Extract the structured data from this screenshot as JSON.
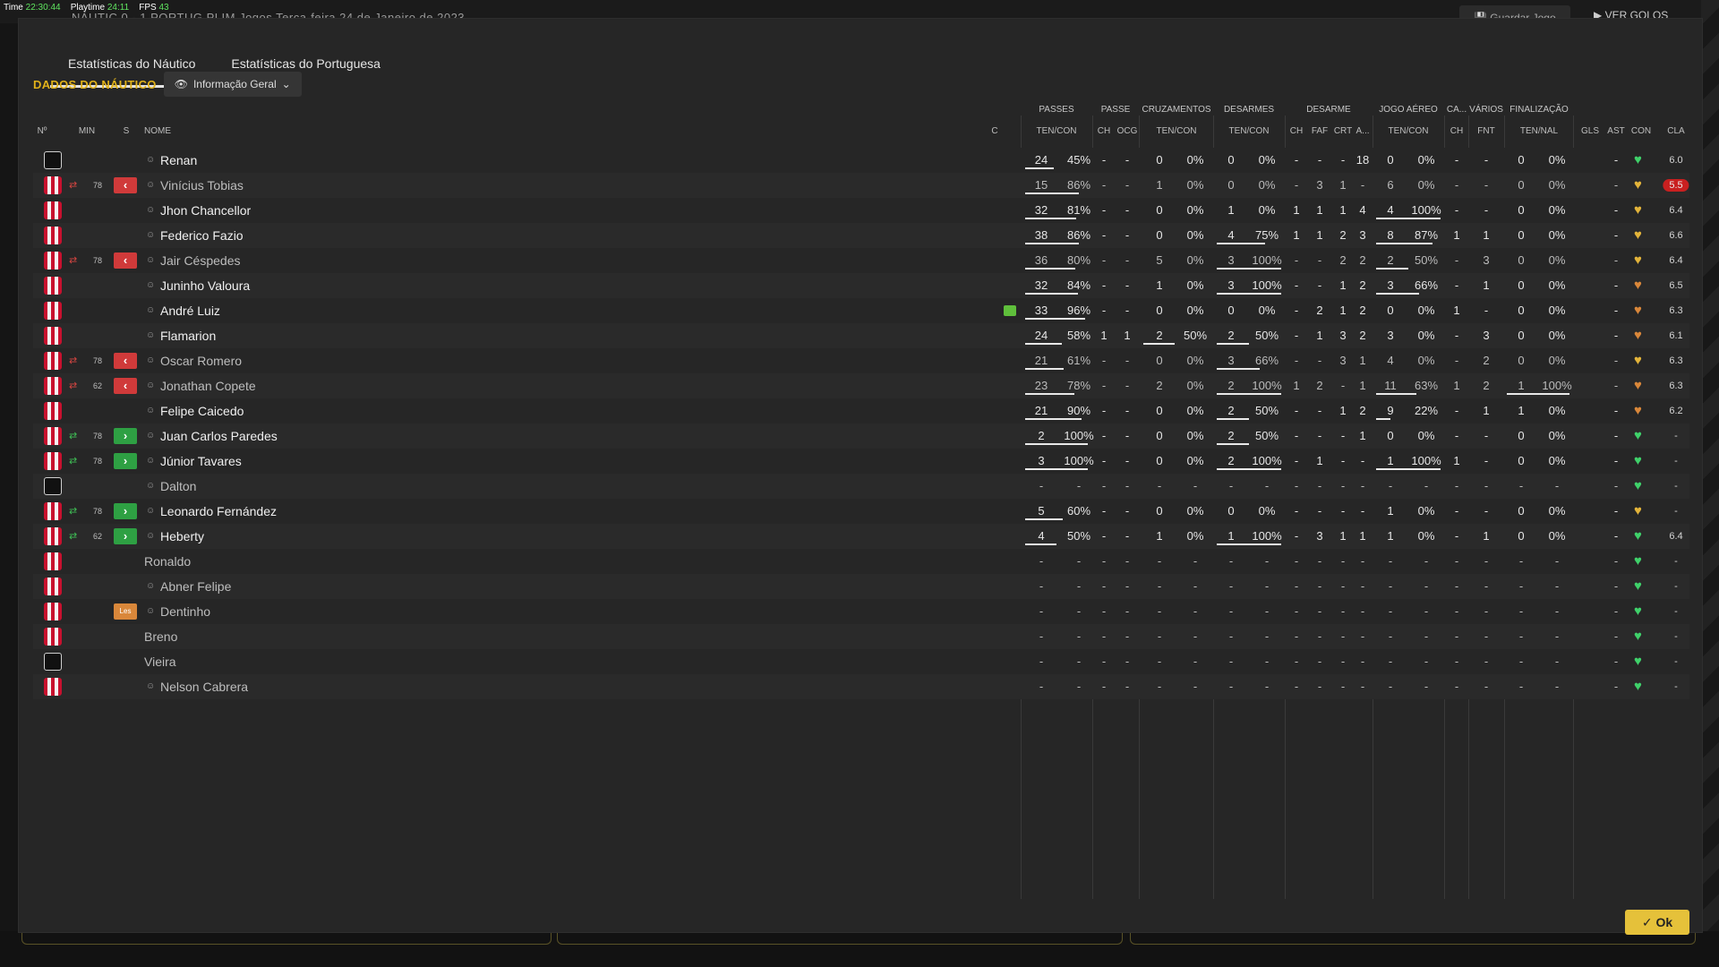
{
  "overlay": {
    "time_label": "Time",
    "time": "22:30:44",
    "playtime_label": "Playtime",
    "playtime": "24:11",
    "fps_label": "FPS",
    "fps": "43"
  },
  "background": {
    "match_text": "NÁUTIC  0 - 1  PORTUG   PLIM Jogos   Terça-feira 24 de Janeiro de 2023",
    "save_label": "Guardar Jogo",
    "goals_label": "VER GOLOS"
  },
  "tabs": [
    {
      "label": "Estatísticas do Náutico"
    },
    {
      "label": "Estatísticas do Portuguesa"
    }
  ],
  "section_title": "DADOS DO NÁUTICO",
  "dropdown": {
    "label": "Informação Geral"
  },
  "group_headers": [
    {
      "label": "PASSES"
    },
    {
      "label": "PASSE"
    },
    {
      "label": "CRUZAMENTOS"
    },
    {
      "label": "DESARMES"
    },
    {
      "label": "DESARME"
    },
    {
      "label": "JOGO AÉREO"
    },
    {
      "label": "CA..."
    },
    {
      "label": "VÁRIOS"
    },
    {
      "label": "FINALIZAÇÃO"
    }
  ],
  "columns": {
    "no": "Nº",
    "min": "MIN",
    "s": "S",
    "name": "NOME",
    "c": "C",
    "passes": "TEN/CON",
    "passe_ch": "CH",
    "passe_ocg": "OCG",
    "cruz": "TEN/CON",
    "des": "TEN/CON",
    "ds_ch": "CH",
    "ds_faf": "FAF",
    "ds_crt": "CRT",
    "ds_a": "A...",
    "aer": "TEN/CON",
    "ca_ch": "CH",
    "fnt": "FNT",
    "fin": "TEN/NAL",
    "gls": "GLS",
    "ast": "AST",
    "con": "CON",
    "cla": "CLA"
  },
  "colors": {
    "accent": "#e0b11a",
    "sub_out": "#d03a3a",
    "sub_in": "#2ea043",
    "heart_green": "#3fd16a",
    "heart_gold": "#e3b43a",
    "heart_orange": "#d9873a",
    "rating_bad": "#c92020"
  },
  "players": [
    {
      "gk": true,
      "sub": "",
      "min": "",
      "s": "",
      "name": "Renan",
      "person": true,
      "card": false,
      "pt": "24",
      "pp": "45%",
      "pb": 0.45,
      "pch": "-",
      "pocg": "-",
      "ct": "0",
      "cp": "0%",
      "cb": 0,
      "dt": "0",
      "dp": "0%",
      "db": 0,
      "dch": "-",
      "dfaf": "-",
      "dcrt": "-",
      "da": "18",
      "at": "0",
      "ap": "0%",
      "ab": 0,
      "cach": "-",
      "fnt": "-",
      "ft": "0",
      "fp": "0%",
      "fb": 0,
      "gls": "",
      "ast": "-",
      "con": "green",
      "cla": "6.0",
      "bad": false,
      "dim": false
    },
    {
      "gk": false,
      "sub": "out",
      "min": "78",
      "s": "out",
      "name": "Vinícius Tobias",
      "person": true,
      "card": false,
      "pt": "15",
      "pp": "86%",
      "pb": 0.86,
      "pch": "-",
      "pocg": "-",
      "ct": "1",
      "cp": "0%",
      "cb": 0,
      "dt": "0",
      "dp": "0%",
      "db": 0,
      "dch": "-",
      "dfaf": "3",
      "dcrt": "1",
      "da": "-",
      "at": "6",
      "ap": "0%",
      "ab": 0,
      "cach": "-",
      "fnt": "-",
      "ft": "0",
      "fp": "0%",
      "fb": 0,
      "gls": "",
      "ast": "-",
      "con": "gold",
      "cla": "5.5",
      "bad": true,
      "dim": true
    },
    {
      "gk": false,
      "sub": "",
      "min": "",
      "s": "",
      "name": "Jhon Chancellor",
      "person": true,
      "card": false,
      "pt": "32",
      "pp": "81%",
      "pb": 0.81,
      "pch": "-",
      "pocg": "-",
      "ct": "0",
      "cp": "0%",
      "cb": 0,
      "dt": "1",
      "dp": "0%",
      "db": 0,
      "dch": "1",
      "dfaf": "1",
      "dcrt": "1",
      "da": "4",
      "at": "4",
      "ap": "100%",
      "ab": 1,
      "cach": "-",
      "fnt": "-",
      "ft": "0",
      "fp": "0%",
      "fb": 0,
      "gls": "",
      "ast": "-",
      "con": "gold",
      "cla": "6.4",
      "bad": false,
      "dim": false
    },
    {
      "gk": false,
      "sub": "",
      "min": "",
      "s": "",
      "name": "Federico Fazio",
      "person": true,
      "card": false,
      "pt": "38",
      "pp": "86%",
      "pb": 0.86,
      "pch": "-",
      "pocg": "-",
      "ct": "0",
      "cp": "0%",
      "cb": 0,
      "dt": "4",
      "dp": "75%",
      "db": 0.75,
      "dch": "1",
      "dfaf": "1",
      "dcrt": "2",
      "da": "3",
      "at": "8",
      "ap": "87%",
      "ab": 0.87,
      "cach": "1",
      "fnt": "1",
      "ft": "0",
      "fp": "0%",
      "fb": 0,
      "gls": "",
      "ast": "-",
      "con": "gold",
      "cla": "6.6",
      "bad": false,
      "dim": false
    },
    {
      "gk": false,
      "sub": "out",
      "min": "78",
      "s": "out",
      "name": "Jair Céspedes",
      "person": true,
      "card": false,
      "pt": "36",
      "pp": "80%",
      "pb": 0.8,
      "pch": "-",
      "pocg": "-",
      "ct": "5",
      "cp": "0%",
      "cb": 0,
      "dt": "3",
      "dp": "100%",
      "db": 1,
      "dch": "-",
      "dfaf": "-",
      "dcrt": "2",
      "da": "2",
      "at": "2",
      "ap": "50%",
      "ab": 0.5,
      "cach": "-",
      "fnt": "3",
      "ft": "0",
      "fp": "0%",
      "fb": 0,
      "gls": "",
      "ast": "-",
      "con": "gold",
      "cla": "6.4",
      "bad": false,
      "dim": true
    },
    {
      "gk": false,
      "sub": "",
      "min": "",
      "s": "",
      "name": "Juninho Valoura",
      "person": true,
      "card": false,
      "pt": "32",
      "pp": "84%",
      "pb": 0.84,
      "pch": "-",
      "pocg": "-",
      "ct": "1",
      "cp": "0%",
      "cb": 0,
      "dt": "3",
      "dp": "100%",
      "db": 1,
      "dch": "-",
      "dfaf": "-",
      "dcrt": "1",
      "da": "2",
      "at": "3",
      "ap": "66%",
      "ab": 0.66,
      "cach": "-",
      "fnt": "1",
      "ft": "0",
      "fp": "0%",
      "fb": 0,
      "gls": "",
      "ast": "-",
      "con": "orange",
      "cla": "6.5",
      "bad": false,
      "dim": false
    },
    {
      "gk": false,
      "sub": "",
      "min": "",
      "s": "",
      "name": "André Luiz",
      "person": true,
      "card": true,
      "pt": "33",
      "pp": "96%",
      "pb": 0.96,
      "pch": "-",
      "pocg": "-",
      "ct": "0",
      "cp": "0%",
      "cb": 0,
      "dt": "0",
      "dp": "0%",
      "db": 0,
      "dch": "-",
      "dfaf": "2",
      "dcrt": "1",
      "da": "2",
      "at": "0",
      "ap": "0%",
      "ab": 0,
      "cach": "1",
      "fnt": "-",
      "ft": "0",
      "fp": "0%",
      "fb": 0,
      "gls": "",
      "ast": "-",
      "con": "orange",
      "cla": "6.3",
      "bad": false,
      "dim": false
    },
    {
      "gk": false,
      "sub": "",
      "min": "",
      "s": "",
      "name": "Flamarion",
      "person": true,
      "card": false,
      "pt": "24",
      "pp": "58%",
      "pb": 0.58,
      "pch": "1",
      "pocg": "1",
      "ct": "2",
      "cp": "50%",
      "cb": 0.5,
      "dt": "2",
      "dp": "50%",
      "db": 0.5,
      "dch": "-",
      "dfaf": "1",
      "dcrt": "3",
      "da": "2",
      "at": "3",
      "ap": "0%",
      "ab": 0,
      "cach": "-",
      "fnt": "3",
      "ft": "0",
      "fp": "0%",
      "fb": 0,
      "gls": "",
      "ast": "-",
      "con": "orange",
      "cla": "6.1",
      "bad": false,
      "dim": false
    },
    {
      "gk": false,
      "sub": "out",
      "min": "78",
      "s": "out",
      "name": "Oscar Romero",
      "person": true,
      "card": false,
      "pt": "21",
      "pp": "61%",
      "pb": 0.61,
      "pch": "-",
      "pocg": "-",
      "ct": "0",
      "cp": "0%",
      "cb": 0,
      "dt": "3",
      "dp": "66%",
      "db": 0.66,
      "dch": "-",
      "dfaf": "-",
      "dcrt": "3",
      "da": "1",
      "at": "4",
      "ap": "0%",
      "ab": 0,
      "cach": "-",
      "fnt": "2",
      "ft": "0",
      "fp": "0%",
      "fb": 0,
      "gls": "",
      "ast": "-",
      "con": "gold",
      "cla": "6.3",
      "bad": false,
      "dim": true
    },
    {
      "gk": false,
      "sub": "out",
      "min": "62",
      "s": "out",
      "name": "Jonathan Copete",
      "person": true,
      "card": false,
      "pt": "23",
      "pp": "78%",
      "pb": 0.78,
      "pch": "-",
      "pocg": "-",
      "ct": "2",
      "cp": "0%",
      "cb": 0,
      "dt": "2",
      "dp": "100%",
      "db": 1,
      "dch": "1",
      "dfaf": "2",
      "dcrt": "-",
      "da": "1",
      "at": "11",
      "ap": "63%",
      "ab": 0.63,
      "cach": "1",
      "fnt": "2",
      "ft": "1",
      "fp": "100%",
      "fb": 1,
      "gls": "",
      "ast": "-",
      "con": "orange",
      "cla": "6.3",
      "bad": false,
      "dim": true
    },
    {
      "gk": false,
      "sub": "",
      "min": "",
      "s": "",
      "name": "Felipe Caicedo",
      "person": true,
      "card": false,
      "pt": "21",
      "pp": "90%",
      "pb": 0.9,
      "pch": "-",
      "pocg": "-",
      "ct": "0",
      "cp": "0%",
      "cb": 0,
      "dt": "2",
      "dp": "50%",
      "db": 0.5,
      "dch": "-",
      "dfaf": "-",
      "dcrt": "1",
      "da": "2",
      "at": "9",
      "ap": "22%",
      "ab": 0.22,
      "cach": "-",
      "fnt": "1",
      "ft": "1",
      "fp": "0%",
      "fb": 0,
      "gls": "",
      "ast": "-",
      "con": "orange",
      "cla": "6.2",
      "bad": false,
      "dim": false
    },
    {
      "gk": false,
      "sub": "in",
      "min": "78",
      "s": "in",
      "name": "Juan Carlos Paredes",
      "person": true,
      "card": false,
      "pt": "2",
      "pp": "100%",
      "pb": 1,
      "pch": "-",
      "pocg": "-",
      "ct": "0",
      "cp": "0%",
      "cb": 0,
      "dt": "2",
      "dp": "50%",
      "db": 0.5,
      "dch": "-",
      "dfaf": "-",
      "dcrt": "-",
      "da": "1",
      "at": "0",
      "ap": "0%",
      "ab": 0,
      "cach": "-",
      "fnt": "-",
      "ft": "0",
      "fp": "0%",
      "fb": 0,
      "gls": "",
      "ast": "-",
      "con": "green",
      "cla": "-",
      "bad": false,
      "dim": false
    },
    {
      "gk": false,
      "sub": "in",
      "min": "78",
      "s": "in",
      "name": "Júnior Tavares",
      "person": true,
      "card": false,
      "pt": "3",
      "pp": "100%",
      "pb": 1,
      "pch": "-",
      "pocg": "-",
      "ct": "0",
      "cp": "0%",
      "cb": 0,
      "dt": "2",
      "dp": "100%",
      "db": 1,
      "dch": "-",
      "dfaf": "1",
      "dcrt": "-",
      "da": "-",
      "at": "1",
      "ap": "100%",
      "ab": 1,
      "cach": "1",
      "fnt": "-",
      "ft": "0",
      "fp": "0%",
      "fb": 0,
      "gls": "",
      "ast": "-",
      "con": "green",
      "cla": "-",
      "bad": false,
      "dim": false
    },
    {
      "gk": true,
      "sub": "",
      "min": "",
      "s": "",
      "name": "Dalton",
      "person": true,
      "card": false,
      "pt": "-",
      "pp": "-",
      "pb": 0,
      "pch": "-",
      "pocg": "-",
      "ct": "-",
      "cp": "-",
      "cb": 0,
      "dt": "-",
      "dp": "-",
      "db": 0,
      "dch": "-",
      "dfaf": "-",
      "dcrt": "-",
      "da": "-",
      "at": "-",
      "ap": "-",
      "ab": 0,
      "cach": "-",
      "fnt": "-",
      "ft": "-",
      "fp": "-",
      "fb": 0,
      "gls": "",
      "ast": "-",
      "con": "green",
      "cla": "-",
      "bad": false,
      "dim": true
    },
    {
      "gk": false,
      "sub": "in",
      "min": "78",
      "s": "in",
      "name": "Leonardo Fernández",
      "person": true,
      "card": false,
      "pt": "5",
      "pp": "60%",
      "pb": 0.6,
      "pch": "-",
      "pocg": "-",
      "ct": "0",
      "cp": "0%",
      "cb": 0,
      "dt": "0",
      "dp": "0%",
      "db": 0,
      "dch": "-",
      "dfaf": "-",
      "dcrt": "-",
      "da": "-",
      "at": "1",
      "ap": "0%",
      "ab": 0,
      "cach": "-",
      "fnt": "-",
      "ft": "0",
      "fp": "0%",
      "fb": 0,
      "gls": "",
      "ast": "-",
      "con": "gold",
      "cla": "-",
      "bad": false,
      "dim": false
    },
    {
      "gk": false,
      "sub": "in",
      "min": "62",
      "s": "in",
      "name": "Heberty",
      "person": true,
      "card": false,
      "pt": "4",
      "pp": "50%",
      "pb": 0.5,
      "pch": "-",
      "pocg": "-",
      "ct": "1",
      "cp": "0%",
      "cb": 0,
      "dt": "1",
      "dp": "100%",
      "db": 1,
      "dch": "-",
      "dfaf": "3",
      "dcrt": "1",
      "da": "1",
      "at": "1",
      "ap": "0%",
      "ab": 0,
      "cach": "-",
      "fnt": "1",
      "ft": "0",
      "fp": "0%",
      "fb": 0,
      "gls": "",
      "ast": "-",
      "con": "green",
      "cla": "6.4",
      "bad": false,
      "dim": false
    },
    {
      "gk": false,
      "sub": "",
      "min": "",
      "s": "",
      "name": "Ronaldo",
      "person": false,
      "card": false,
      "pt": "-",
      "pp": "-",
      "pb": 0,
      "pch": "-",
      "pocg": "-",
      "ct": "-",
      "cp": "-",
      "cb": 0,
      "dt": "-",
      "dp": "-",
      "db": 0,
      "dch": "-",
      "dfaf": "-",
      "dcrt": "-",
      "da": "-",
      "at": "-",
      "ap": "-",
      "ab": 0,
      "cach": "-",
      "fnt": "-",
      "ft": "-",
      "fp": "-",
      "fb": 0,
      "gls": "",
      "ast": "-",
      "con": "green",
      "cla": "-",
      "bad": false,
      "dim": true
    },
    {
      "gk": false,
      "sub": "",
      "min": "",
      "s": "",
      "name": "Abner Felipe",
      "person": true,
      "card": false,
      "pt": "-",
      "pp": "-",
      "pb": 0,
      "pch": "-",
      "pocg": "-",
      "ct": "-",
      "cp": "-",
      "cb": 0,
      "dt": "-",
      "dp": "-",
      "db": 0,
      "dch": "-",
      "dfaf": "-",
      "dcrt": "-",
      "da": "-",
      "at": "-",
      "ap": "-",
      "ab": 0,
      "cach": "-",
      "fnt": "-",
      "ft": "-",
      "fp": "-",
      "fb": 0,
      "gls": "",
      "ast": "-",
      "con": "green",
      "cla": "-",
      "bad": false,
      "dim": true
    },
    {
      "gk": false,
      "sub": "",
      "min": "",
      "s": "inj",
      "inj_label": "Les",
      "name": "Dentinho",
      "person": true,
      "card": false,
      "pt": "-",
      "pp": "-",
      "pb": 0,
      "pch": "-",
      "pocg": "-",
      "ct": "-",
      "cp": "-",
      "cb": 0,
      "dt": "-",
      "dp": "-",
      "db": 0,
      "dch": "-",
      "dfaf": "-",
      "dcrt": "-",
      "da": "-",
      "at": "-",
      "ap": "-",
      "ab": 0,
      "cach": "-",
      "fnt": "-",
      "ft": "-",
      "fp": "-",
      "fb": 0,
      "gls": "",
      "ast": "-",
      "con": "green",
      "cla": "-",
      "bad": false,
      "dim": true
    },
    {
      "gk": false,
      "sub": "",
      "min": "",
      "s": "",
      "name": "Breno",
      "person": false,
      "card": false,
      "pt": "-",
      "pp": "-",
      "pb": 0,
      "pch": "-",
      "pocg": "-",
      "ct": "-",
      "cp": "-",
      "cb": 0,
      "dt": "-",
      "dp": "-",
      "db": 0,
      "dch": "-",
      "dfaf": "-",
      "dcrt": "-",
      "da": "-",
      "at": "-",
      "ap": "-",
      "ab": 0,
      "cach": "-",
      "fnt": "-",
      "ft": "-",
      "fp": "-",
      "fb": 0,
      "gls": "",
      "ast": "-",
      "con": "green",
      "cla": "-",
      "bad": false,
      "dim": true
    },
    {
      "gk": true,
      "sub": "",
      "min": "",
      "s": "",
      "name": "Vieira",
      "person": false,
      "card": false,
      "pt": "-",
      "pp": "-",
      "pb": 0,
      "pch": "-",
      "pocg": "-",
      "ct": "-",
      "cp": "-",
      "cb": 0,
      "dt": "-",
      "dp": "-",
      "db": 0,
      "dch": "-",
      "dfaf": "-",
      "dcrt": "-",
      "da": "-",
      "at": "-",
      "ap": "-",
      "ab": 0,
      "cach": "-",
      "fnt": "-",
      "ft": "-",
      "fp": "-",
      "fb": 0,
      "gls": "",
      "ast": "-",
      "con": "green",
      "cla": "-",
      "bad": false,
      "dim": true
    },
    {
      "gk": false,
      "sub": "",
      "min": "",
      "s": "",
      "name": "Nelson Cabrera",
      "person": true,
      "card": false,
      "pt": "-",
      "pp": "-",
      "pb": 0,
      "pch": "-",
      "pocg": "-",
      "ct": "-",
      "cp": "-",
      "cb": 0,
      "dt": "-",
      "dp": "-",
      "db": 0,
      "dch": "-",
      "dfaf": "-",
      "dcrt": "-",
      "da": "-",
      "at": "-",
      "ap": "-",
      "ab": 0,
      "cach": "-",
      "fnt": "-",
      "ft": "-",
      "fp": "-",
      "fb": 0,
      "gls": "",
      "ast": "-",
      "con": "green",
      "cla": "-",
      "bad": false,
      "dim": true
    }
  ],
  "ok_button": {
    "label": "Ok"
  }
}
